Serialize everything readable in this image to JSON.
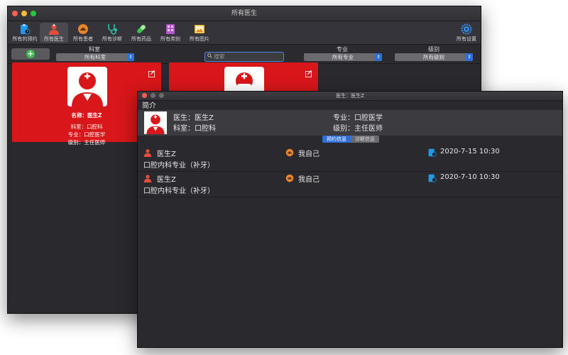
{
  "main_window": {
    "title": "所有医生",
    "toolbar": [
      {
        "label": "所有的预约",
        "icon": "appointment-clipboard-icon",
        "active": false
      },
      {
        "label": "所有医生",
        "icon": "doctor-icon",
        "active": true
      },
      {
        "label": "所有患者",
        "icon": "patient-icon",
        "active": false
      },
      {
        "label": "所有诊断",
        "icon": "stethoscope-icon",
        "active": false
      },
      {
        "label": "所有药品",
        "icon": "pill-icon",
        "active": false
      },
      {
        "label": "所有类别",
        "icon": "category-icon",
        "active": false
      },
      {
        "label": "所有图片",
        "icon": "image-icon",
        "active": false
      }
    ],
    "settings_label": "所有设置",
    "filters": {
      "department_label": "科室",
      "department_value": "所有科室",
      "search_placeholder": "搜索",
      "specialty_label": "专业",
      "specialty_value": "所有专业",
      "level_label": "级别",
      "level_value": "所有级别"
    },
    "cards": [
      {
        "name": "名称：医生Z",
        "department": "科室：口腔科",
        "specialty": "专业：口腔医学",
        "level": "级别：主任医师"
      }
    ]
  },
  "detail_window": {
    "title": "医生：医生Z",
    "section_title": "简介",
    "info": {
      "doctor": "医生：医生Z",
      "department": "科室：口腔科",
      "specialty": "专业：口腔医学",
      "level": "级别：主任医师"
    },
    "tabs": [
      {
        "label": "预约信息",
        "active": true
      },
      {
        "label": "诊断信息",
        "active": false
      }
    ],
    "appointments": [
      {
        "doctor": "医生Z",
        "patient": "我自己",
        "datetime": "2020-7-15 10:30",
        "description": "口腔内科专业（补牙）"
      },
      {
        "doctor": "医生Z",
        "patient": "我自己",
        "datetime": "2020-7-10 10:30",
        "description": "口腔内科专业（补牙）"
      }
    ]
  },
  "colors": {
    "card_red": "#d9161a",
    "accent_blue": "#2f6fd8",
    "add_green": "#3dbf4e",
    "patient_orange": "#e8842a",
    "clipboard_blue": "#1e9be8"
  }
}
